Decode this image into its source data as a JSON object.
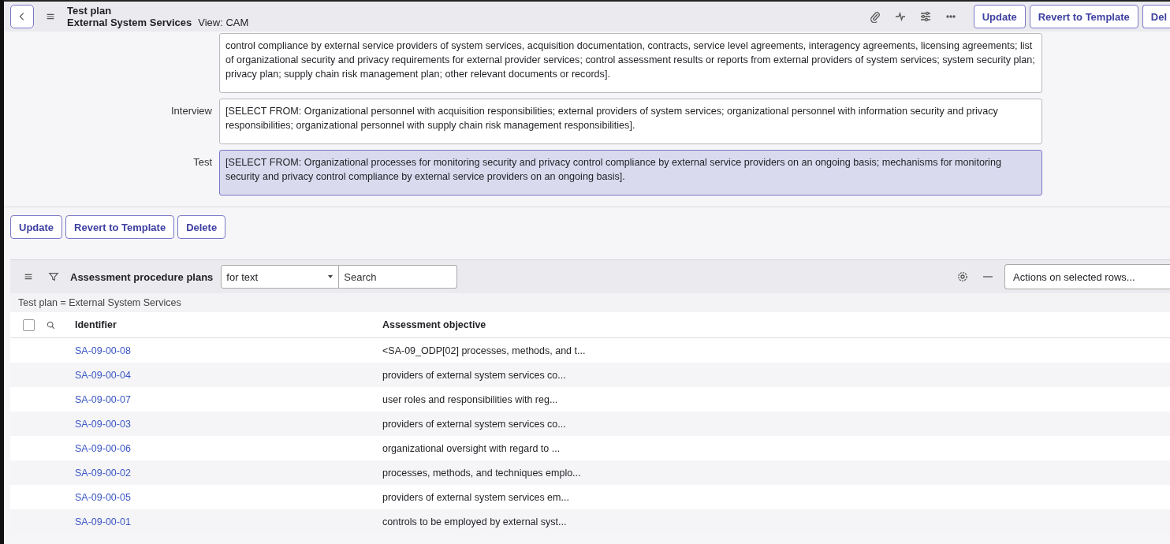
{
  "header": {
    "title": "Test plan",
    "subtitle": "External System Services",
    "view": "View: CAM",
    "buttons": [
      "Update",
      "Revert to Template",
      "Del"
    ]
  },
  "fields": [
    {
      "value": "control compliance by external service providers of system services, acquisition documentation, contracts, service level agreements, interagency agreements, licensing agreements; list of organizational security and privacy requirements for external provider services; control assessment results or reports from external providers of system services; system security plan; privacy plan; supply chain risk management plan; other relevant documents or records].",
      "focused": false
    },
    {
      "label": "Interview",
      "value": "[SELECT FROM: Organizational personnel with acquisition responsibilities; external providers of system services; organizational personnel with information security and privacy responsibilities; organizational personnel with supply chain risk management responsibilities].",
      "focused": false
    },
    {
      "label": "Test",
      "value": "[SELECT FROM: Organizational processes for monitoring security and privacy control compliance by external service providers on an ongoing basis; mechanisms for monitoring security and privacy control compliance by external service providers on an ongoing basis].",
      "focused": true
    }
  ],
  "form_buttons": [
    "Update",
    "Revert to Template",
    "Delete"
  ],
  "list": {
    "title": "Assessment procedure plans",
    "search_scope": "for text",
    "search_placeholder": "Search",
    "actions": "Actions on selected rows...",
    "filter": "Test plan = External System Services",
    "columns": [
      "Identifier",
      "Assessment objective"
    ],
    "select_all_checked": false,
    "rows": [
      {
        "identifier": "SA-09-00-08",
        "objective": "<SA-09_ODP[02] processes, methods, and t..."
      },
      {
        "identifier": "SA-09-00-04",
        "objective": "providers of external system services co..."
      },
      {
        "identifier": "SA-09-00-07",
        "objective": "user roles and responsibilities with reg..."
      },
      {
        "identifier": "SA-09-00-03",
        "objective": "providers of external system services co..."
      },
      {
        "identifier": "SA-09-00-06",
        "objective": "organizational oversight with regard to ..."
      },
      {
        "identifier": "SA-09-00-02",
        "objective": "processes, methods, and techniques emplo..."
      },
      {
        "identifier": "SA-09-00-05",
        "objective": "providers of external system services em..."
      },
      {
        "identifier": "SA-09-00-01",
        "objective": "controls to be employed by external syst..."
      }
    ]
  }
}
